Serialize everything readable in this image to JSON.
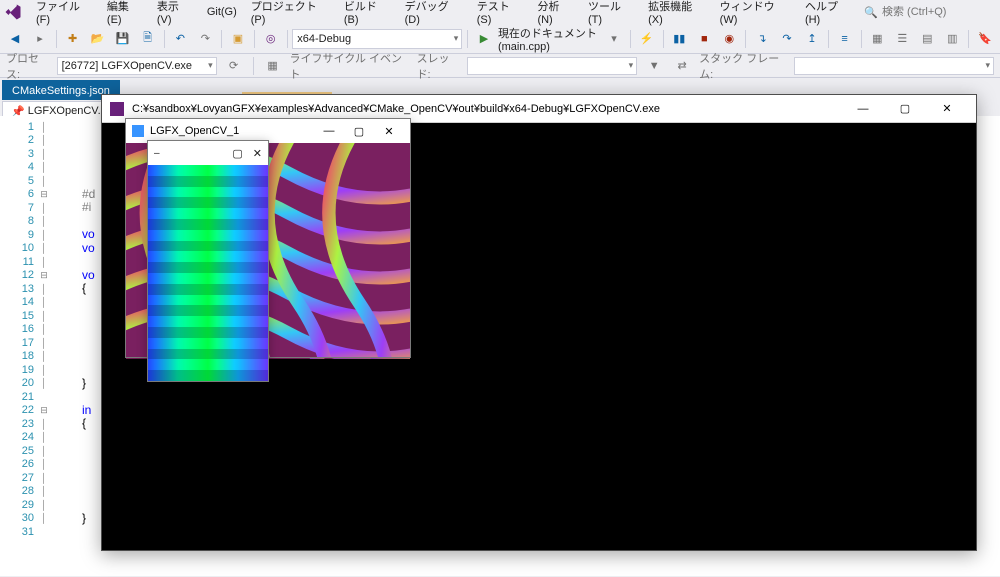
{
  "menu": {
    "items": [
      "ファイル(F)",
      "編集(E)",
      "表示(V)",
      "Git(G)",
      "プロジェクト(P)",
      "ビルド(B)",
      "デバッグ(D)",
      "テスト(S)",
      "分析(N)",
      "ツール(T)",
      "拡張機能(X)",
      "ウィンドウ(W)",
      "ヘルプ(H)"
    ],
    "search_placeholder": "検索 (Ctrl+Q)"
  },
  "toolbar": {
    "config_combo": "x64-Debug",
    "doc_label": "現在のドキュメント (main.cpp)"
  },
  "procbar": {
    "label": "プロセス:",
    "process": "[26772] LGFXOpenCV.exe",
    "lifecycle_label": "ライフサイクル イベント",
    "thread_label": "スレッド:",
    "stackframe_label": "スタック フレーム:"
  },
  "tabs": {
    "row1": [
      "CMakeSettings.json"
    ],
    "row2": "LGFXOpenCV.e..."
  },
  "code": {
    "total_lines": 31,
    "tokens": {
      "l6": "#d",
      "l7": "#i",
      "l9": "vo",
      "l10": "vo",
      "l12": "vo",
      "l13": "{",
      "l20": "}",
      "l22": "in",
      "l23": "{",
      "l30": "}"
    }
  },
  "console": {
    "title": "C:¥sandbox¥LovyanGFX¥examples¥Advanced¥CMake_OpenCV¥out¥build¥x64-Debug¥LGFXOpenCV.exe"
  },
  "lgfx_window": {
    "title": "LGFX_OpenCV_1"
  }
}
